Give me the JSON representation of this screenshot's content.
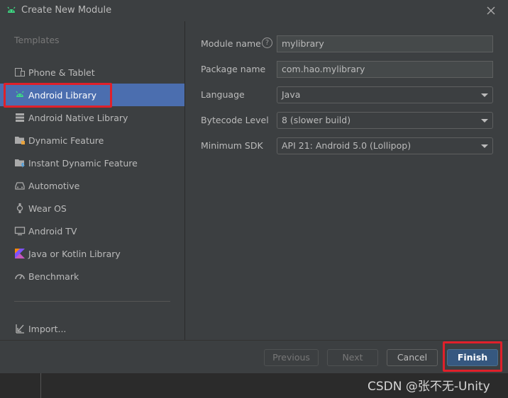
{
  "window": {
    "title": "Create New Module",
    "close_icon": "close-icon",
    "app_icon": "android-icon"
  },
  "sidebar": {
    "heading": "Templates",
    "selected_index": 1,
    "items": [
      {
        "label": "Phone & Tablet",
        "icon": "phone-tablet-icon"
      },
      {
        "label": "Android Library",
        "icon": "android-icon"
      },
      {
        "label": "Android Native Library",
        "icon": "native-library-icon"
      },
      {
        "label": "Dynamic Feature",
        "icon": "folder-feature-icon"
      },
      {
        "label": "Instant Dynamic Feature",
        "icon": "folder-instant-icon"
      },
      {
        "label": "Automotive",
        "icon": "car-icon"
      },
      {
        "label": "Wear OS",
        "icon": "watch-icon"
      },
      {
        "label": "Android TV",
        "icon": "tv-icon"
      },
      {
        "label": "Java or Kotlin Library",
        "icon": "kotlin-icon"
      },
      {
        "label": "Benchmark",
        "icon": "gauge-icon"
      }
    ],
    "import_label": "Import..."
  },
  "form": {
    "module_name": {
      "label": "Module name",
      "value": "mylibrary"
    },
    "package_name": {
      "label": "Package name",
      "value": "com.hao.mylibrary"
    },
    "language": {
      "label": "Language",
      "value": "Java"
    },
    "bytecode_level": {
      "label": "Bytecode Level",
      "value": "8 (slower build)"
    },
    "minimum_sdk": {
      "label": "Minimum SDK",
      "value": "API 21: Android 5.0 (Lollipop)"
    }
  },
  "buttons": {
    "previous": "Previous",
    "next": "Next",
    "cancel": "Cancel",
    "finish": "Finish"
  },
  "watermark": "CSDN @张不无-Unity",
  "colors": {
    "selection": "#4b6eaf",
    "highlight_box": "#e0202a",
    "android_green": "#3ddc84",
    "primary_button": "#365880"
  }
}
